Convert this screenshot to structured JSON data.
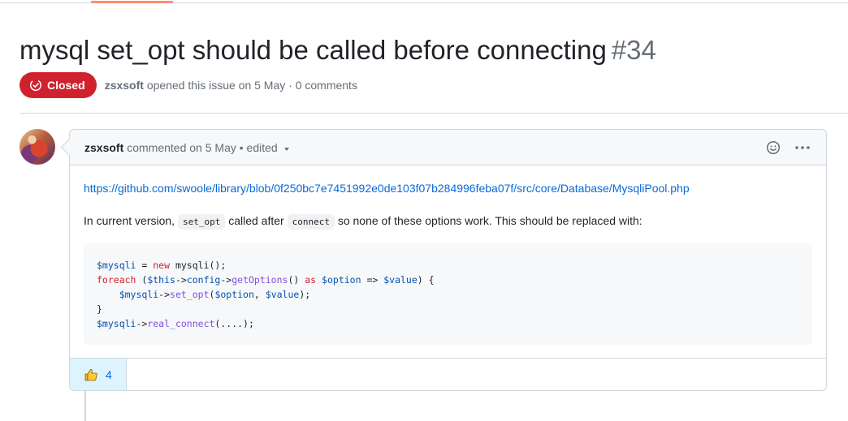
{
  "issue": {
    "title": "mysql set_opt should be called before connecting",
    "number": "#34",
    "state": "Closed",
    "author": "zsxsoft",
    "meta": "opened this issue on 5 May · 0 comments"
  },
  "comment": {
    "author": "zsxsoft",
    "header_text": "commented on 5 May • edited",
    "link": "https://github.com/swoole/library/blob/0f250bc7e7451992e0de103f07b284996feba07f/src/core/Database/MysqliPool.php",
    "paragraph": {
      "part1": "In current version,",
      "code1": "set_opt",
      "part2": "called after",
      "code2": "connect",
      "part3": "so none of these options work. This should be replaced with:"
    },
    "code_lines": [
      "$mysqli = new mysqli();",
      "foreach ($this->config->getOptions() as $option => $value) {",
      "    $mysqli->set_opt($option, $value);",
      "}",
      "$mysqli->real_connect(....);"
    ]
  },
  "reactions": [
    {
      "emoji": "thumbs-up",
      "count": "4"
    }
  ],
  "icons": {
    "state": "issue-closed-icon",
    "smiley": "smiley-icon",
    "more": "kebab-horizontal-icon",
    "caret": "triangle-down-icon"
  },
  "colors": {
    "closed_badge": "#cf222e",
    "link": "#0969da",
    "reaction_bg": "#ddf4ff",
    "tab_indicator": "#fd8c73"
  }
}
